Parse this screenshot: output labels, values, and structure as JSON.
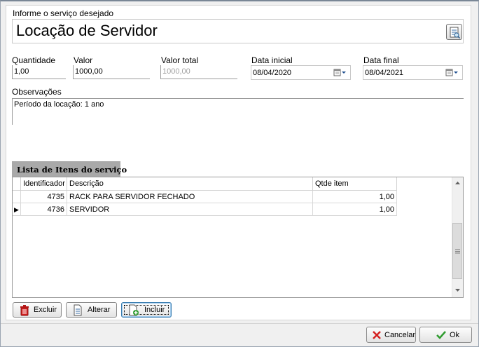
{
  "service": {
    "label": "Informe o serviço desejado",
    "value": "Locação de Servidor",
    "lookup_icon": "document-search-icon"
  },
  "fields": {
    "quantidade": {
      "label": "Quantidade",
      "value": "1,00"
    },
    "valor": {
      "label": "Valor",
      "value": "1000,00"
    },
    "valor_total": {
      "label": "Valor total",
      "value": "1000,00"
    },
    "data_inicial": {
      "label": "Data inicial",
      "value": "08/04/2020"
    },
    "data_final": {
      "label": "Data final",
      "value": "08/04/2021"
    }
  },
  "observacoes": {
    "label": "Observações",
    "value": "Período da locação: 1 ano"
  },
  "items_tab": {
    "label": "Lista de Itens do serviço"
  },
  "items_grid": {
    "columns": [
      "Identificador",
      "Descrição",
      "Qtde item"
    ],
    "rows": [
      {
        "id": "4735",
        "descricao": "RACK PARA SERVIDOR FECHADO",
        "qtde": "1,00"
      },
      {
        "id": "4736",
        "descricao": "SERVIDOR",
        "qtde": "1,00"
      }
    ],
    "current_row_indicator": "▶"
  },
  "actions": {
    "excluir": "Excluir",
    "alterar": "Alterar",
    "incluir": "Incluir"
  },
  "dialog": {
    "cancel": "Cancelar",
    "ok": "Ok"
  },
  "colors": {
    "tab_bg": "#a9a9a9",
    "cancel_icon": "#d42020",
    "ok_icon": "#2e9b2e"
  }
}
